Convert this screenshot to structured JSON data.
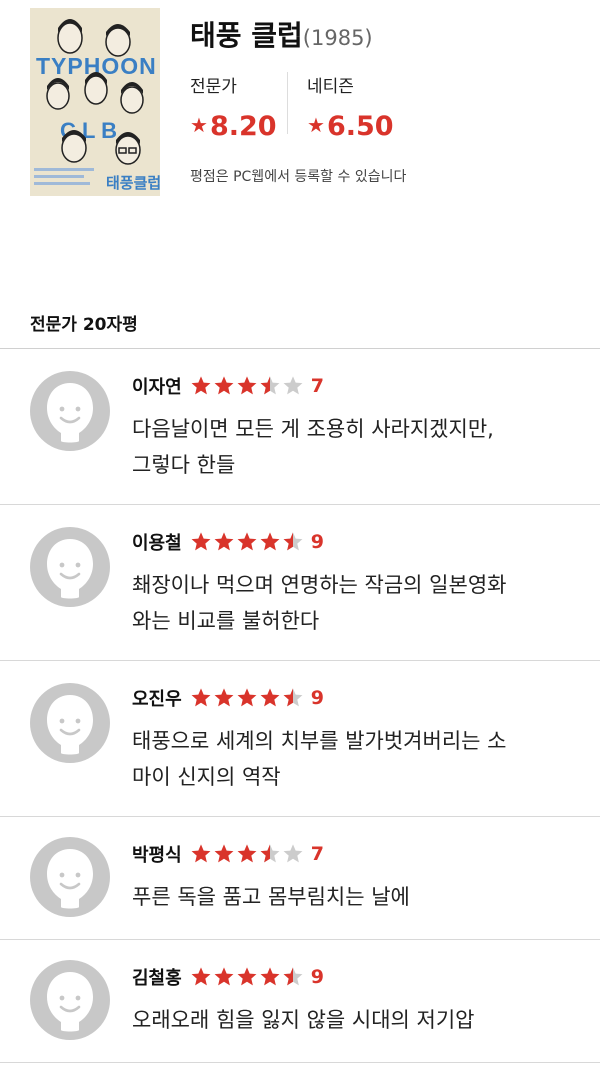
{
  "movie": {
    "title": "태풍 클럽",
    "year": "(1985)",
    "poster": {
      "name": "Typhoon Club poster",
      "title_text": "Typhoon Club",
      "korean_title": "태풍클럽"
    }
  },
  "ratings": {
    "critic_label": "전문가",
    "critic_value": "8.20",
    "netizen_label": "네티즌",
    "netizen_value": "6.50",
    "star_icon": "star-icon",
    "note": "평점은 PC웹에서 등록할 수 있습니다"
  },
  "section": {
    "title": "전문가 20자평"
  },
  "colors": {
    "accent": "#d9342b",
    "star_empty": "#cccccc",
    "avatar": "#c8c8c8"
  },
  "reviews": [
    {
      "name": "이자연",
      "stars": 3.5,
      "score": "7",
      "comment": [
        "다음날이면 모든 게 조용히 사라지겠지만,",
        "그렇다 한들"
      ]
    },
    {
      "name": "이용철",
      "stars": 4.5,
      "score": "9",
      "comment": [
        "쵀장이나 먹으며 연명하는 작금의 일본영화",
        "와는 비교를 불허한다"
      ]
    },
    {
      "name": "오진우",
      "stars": 4.5,
      "score": "9",
      "comment": [
        "태풍으로 세계의 치부를 발가벗겨버리는 소",
        "마이 신지의 역작"
      ]
    },
    {
      "name": "박평식",
      "stars": 3.5,
      "score": "7",
      "comment": [
        "푸른 독을 품고 몸부림치는 날에"
      ]
    },
    {
      "name": "김철홍",
      "stars": 4.5,
      "score": "9",
      "comment": [
        "오래오래 힘을 잃지 않을 시대의 저기압"
      ]
    }
  ]
}
